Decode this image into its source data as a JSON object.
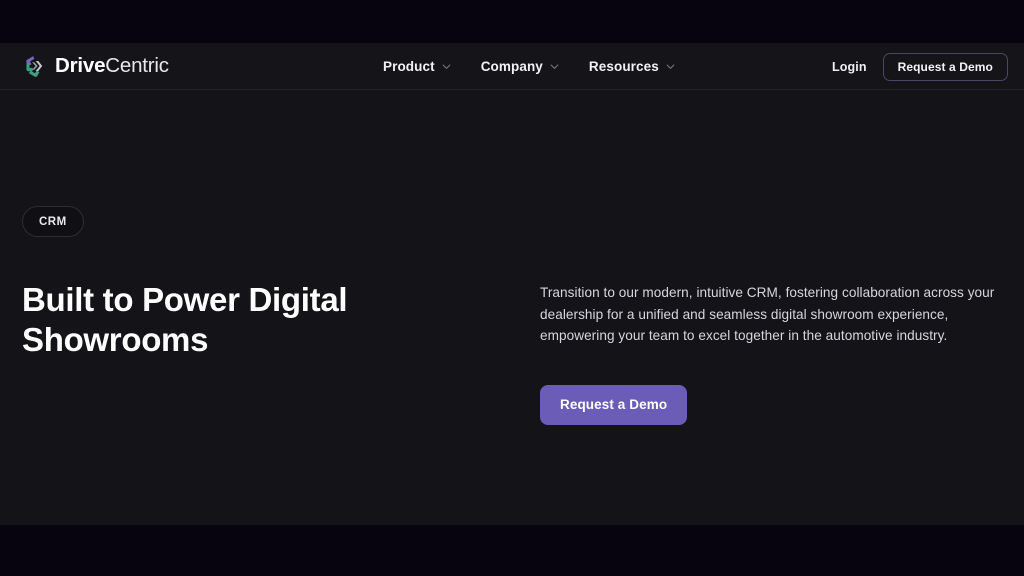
{
  "theme": {
    "page_background": "#141418",
    "header_background": "#151519",
    "letterbox_color": "#07030f",
    "accent_purple": "#6b5cb8",
    "border_color": "#242428",
    "text_primary": "#ffffff",
    "text_secondary": "#d6d6dc"
  },
  "header": {
    "brand": {
      "logo_icon": "drivecentric-pinwheel-logo",
      "name_bold": "Drive",
      "name_regular": "Centric",
      "logo_colors": {
        "purple": "#7b5fc4",
        "green": "#3aa87a",
        "gray": "#b9bac4"
      }
    },
    "nav": [
      {
        "label": "Product",
        "icon": "chevron-down-icon"
      },
      {
        "label": "Company",
        "icon": "chevron-down-icon"
      },
      {
        "label": "Resources",
        "icon": "chevron-down-icon"
      }
    ],
    "login_label": "Login",
    "demo_button_label": "Request a Demo"
  },
  "hero": {
    "badge_label": "CRM",
    "title": "Built to Power Digital Showrooms",
    "body": "Transition to our modern, intuitive CRM, fostering collaboration across your dealership for a unified and seamless digital showroom experience, empowering your team to excel together in the automotive industry.",
    "cta_label": "Request a Demo"
  }
}
